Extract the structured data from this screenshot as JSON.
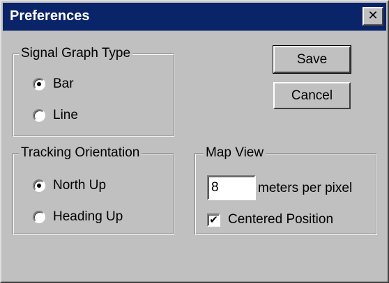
{
  "window": {
    "title": "Preferences",
    "close_glyph": "✕"
  },
  "signal_graph": {
    "legend": "Signal Graph Type",
    "options": [
      {
        "label": "Bar",
        "selected": true
      },
      {
        "label": "Line",
        "selected": false
      }
    ]
  },
  "tracking": {
    "legend": "Tracking Orientation",
    "options": [
      {
        "label": "North Up",
        "selected": true
      },
      {
        "label": "Heading Up",
        "selected": false
      }
    ]
  },
  "map_view": {
    "legend": "Map View",
    "scale_value": "8",
    "scale_suffix": "meters per pixel",
    "centered_label": "Centered Position",
    "centered_checked": true,
    "check_glyph": "✔"
  },
  "buttons": {
    "save_label": "Save",
    "cancel_label": "Cancel"
  },
  "colors": {
    "titlebar": "#0a246a",
    "face": "#c0c0c0"
  }
}
